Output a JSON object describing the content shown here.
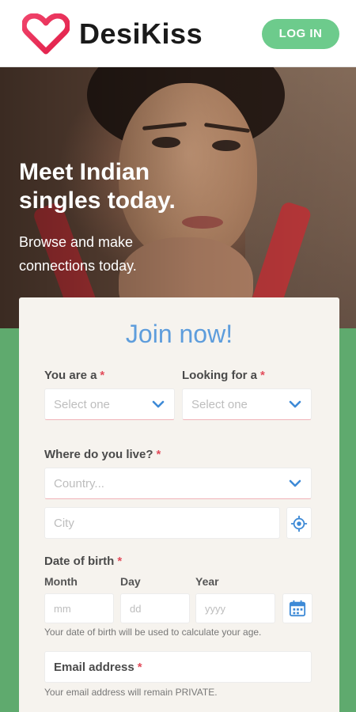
{
  "header": {
    "brand": "DesiKiss",
    "login_label": "LOG IN",
    "accent_color": "#6dcb8c",
    "logo_icon": "heart-logo-icon"
  },
  "hero": {
    "title": "Meet Indian singles today.",
    "subtitle": "Browse and make connections today."
  },
  "form": {
    "title": "Join now!",
    "you_are": {
      "label": "You are a",
      "required": "*",
      "placeholder": "Select one"
    },
    "looking_for": {
      "label": "Looking for a",
      "required": "*",
      "placeholder": "Select one"
    },
    "location": {
      "label": "Where do you live?",
      "required": "*",
      "country_placeholder": "Country...",
      "city_placeholder": "City",
      "locate_icon": "location-target-icon"
    },
    "dob": {
      "label": "Date of birth",
      "required": "*",
      "month_label": "Month",
      "day_label": "Day",
      "year_label": "Year",
      "month_placeholder": "mm",
      "day_placeholder": "dd",
      "year_placeholder": "yyyy",
      "help": "Your date of birth will be used to calculate your age.",
      "calendar_icon": "calendar-icon"
    },
    "email": {
      "label": "Email address",
      "required": "*",
      "help": "Your email address will remain PRIVATE."
    }
  },
  "colors": {
    "title_blue": "#5e9ddc",
    "required_red": "#e24b5a",
    "background_green": "#5faa6e",
    "chevron_blue": "#3e8ad6"
  }
}
